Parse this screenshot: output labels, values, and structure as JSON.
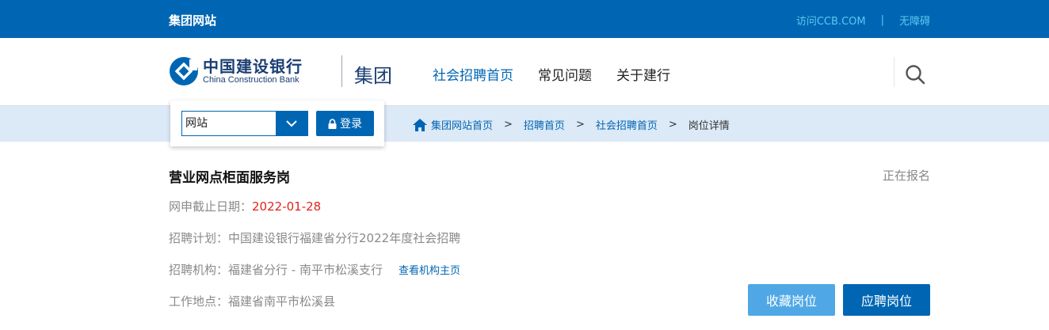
{
  "topbar": {
    "group_site": "集团网站",
    "visit_link": "访问CCB.COM",
    "separator": "|",
    "accessibility": "无障碍"
  },
  "header": {
    "logo_cn": "中国建设银行",
    "logo_en": "China Construction Bank",
    "group_label": "集团",
    "nav": [
      {
        "label": "社会招聘首页",
        "active": true
      },
      {
        "label": "常见问题",
        "active": false
      },
      {
        "label": "关于建行",
        "active": false
      }
    ],
    "search_icon": "search-icon"
  },
  "login_panel": {
    "select_value": "网站",
    "login_label": "登录"
  },
  "breadcrumb": {
    "items": [
      "集团网站首页",
      "招聘首页",
      "社会招聘首页",
      "岗位详情"
    ],
    "separator": ">"
  },
  "job": {
    "title": "营业网点柜面服务岗",
    "status": "正在报名",
    "deadline_label": "网申截止日期：",
    "deadline_value": "2022-01-28",
    "plan_label": "招聘计划：",
    "plan_value": "中国建设银行福建省分行2022年度社会招聘",
    "org_label": "招聘机构：",
    "org_value": "福建省分行 - 南平市松溪支行",
    "org_link": "查看机构主页",
    "location_label": "工作地点：",
    "location_value": "福建省南平市松溪县"
  },
  "actions": {
    "favorite": "收藏岗位",
    "apply": "应聘岗位"
  },
  "colors": {
    "brand_blue": "#0066b3",
    "light_blue_button": "#4fa8e5",
    "deadline_red": "#e0241c",
    "strip_bg": "#dce9f6"
  }
}
